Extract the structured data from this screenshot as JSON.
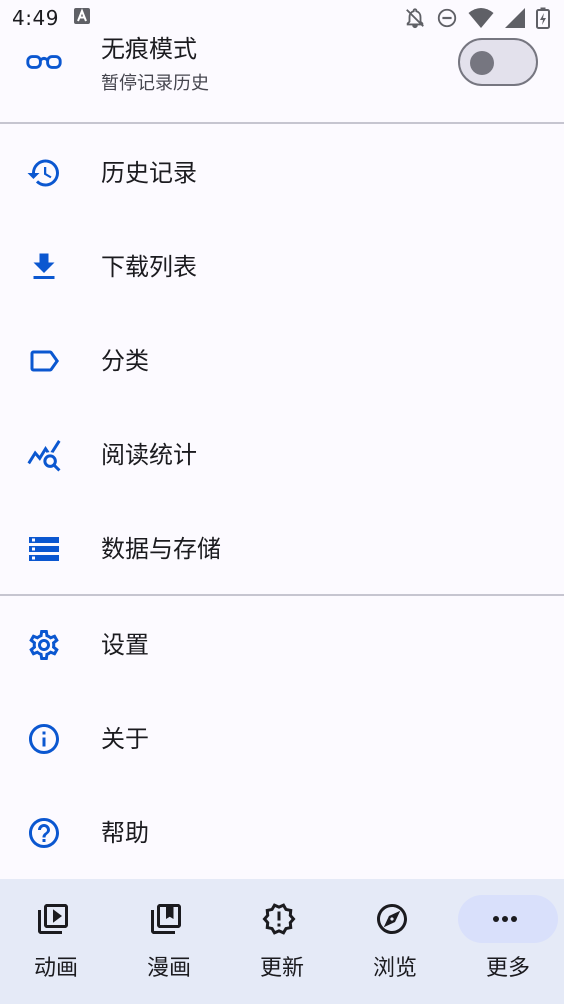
{
  "status_bar": {
    "time": "4:49"
  },
  "incognito": {
    "title": "无痕模式",
    "subtitle": "暂停记录历史",
    "enabled": false
  },
  "menu": {
    "items": [
      {
        "label": "历史记录",
        "icon": "history-icon"
      },
      {
        "label": "下载列表",
        "icon": "download-icon"
      },
      {
        "label": "分类",
        "icon": "label-icon"
      },
      {
        "label": "阅读统计",
        "icon": "query-stats-icon"
      },
      {
        "label": "数据与存储",
        "icon": "storage-icon"
      },
      {
        "label": "设置",
        "icon": "gear-icon"
      },
      {
        "label": "关于",
        "icon": "info-icon"
      },
      {
        "label": "帮助",
        "icon": "help-icon"
      }
    ]
  },
  "bottom_nav": {
    "items": [
      {
        "label": "动画",
        "icon": "video-library-icon"
      },
      {
        "label": "漫画",
        "icon": "collections-bookmark-icon"
      },
      {
        "label": "更新",
        "icon": "new-releases-icon"
      },
      {
        "label": "浏览",
        "icon": "explore-icon"
      },
      {
        "label": "更多",
        "icon": "more-horiz-icon",
        "active": true
      }
    ]
  },
  "colors": {
    "accent": "#0b57d0",
    "background": "#fcfaff",
    "nav_background": "#e5eaf7",
    "nav_active_pill": "#d9e0fb"
  }
}
